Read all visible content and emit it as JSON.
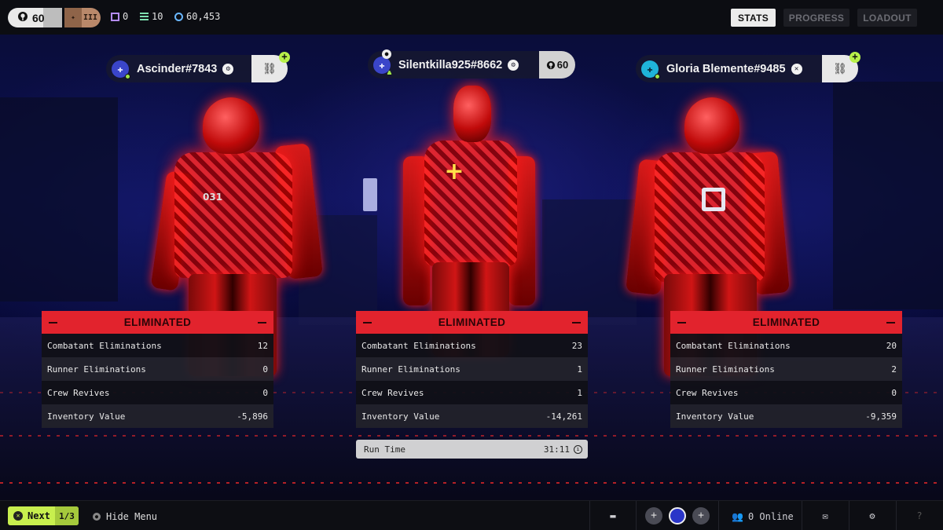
{
  "topbar": {
    "level": "60",
    "rank_label": "III",
    "currencies": [
      {
        "icon": "square-token-icon",
        "color": "#b48cff",
        "value": "0"
      },
      {
        "icon": "stack-icon",
        "color": "#7ee0b0",
        "value": "10"
      },
      {
        "icon": "credits-icon",
        "color": "#6ab7ff",
        "value": "60,453"
      }
    ],
    "tabs": [
      {
        "label": "STATS",
        "active": true
      },
      {
        "label": "PROGRESS",
        "active": false
      },
      {
        "label": "LOADOUT",
        "active": false
      }
    ]
  },
  "players": [
    {
      "name": "Ascinder#7843",
      "platform": "steam-icon",
      "avatar_color": "#3a45c9",
      "status": "ELIMINATED",
      "stats": [
        {
          "label": "Combatant Eliminations",
          "value": "12"
        },
        {
          "label": "Runner Eliminations",
          "value": "0"
        },
        {
          "label": "Crew Revives",
          "value": "0"
        },
        {
          "label": "Inventory Value",
          "value": "-5,896"
        }
      ]
    },
    {
      "name": "Silentkilla925#8662",
      "platform": "steam-icon",
      "avatar_color": "#3a45c9",
      "level": "60",
      "status": "ELIMINATED",
      "stats": [
        {
          "label": "Combatant Eliminations",
          "value": "23"
        },
        {
          "label": "Runner Eliminations",
          "value": "1"
        },
        {
          "label": "Crew Revives",
          "value": "1"
        },
        {
          "label": "Inventory Value",
          "value": "-14,261"
        }
      ]
    },
    {
      "name": "Gloria Blemente#9485",
      "platform": "xbox-icon",
      "avatar_color": "#1fb3d9",
      "status": "ELIMINATED",
      "stats": [
        {
          "label": "Combatant Eliminations",
          "value": "20"
        },
        {
          "label": "Runner Eliminations",
          "value": "2"
        },
        {
          "label": "Crew Revives",
          "value": "0"
        },
        {
          "label": "Inventory Value",
          "value": "-9,359"
        }
      ]
    }
  ],
  "run": {
    "label": "Run Time",
    "value": "31:11"
  },
  "bottombar": {
    "next_label": "Next",
    "next_count": "1/3",
    "hide_menu_label": "Hide Menu",
    "online_label": "0 Online",
    "help_label": "?"
  },
  "colors": {
    "eliminated_red": "#e2232d",
    "accent_lime": "#c8ef4e",
    "scene_blue": "#0b0f52"
  }
}
